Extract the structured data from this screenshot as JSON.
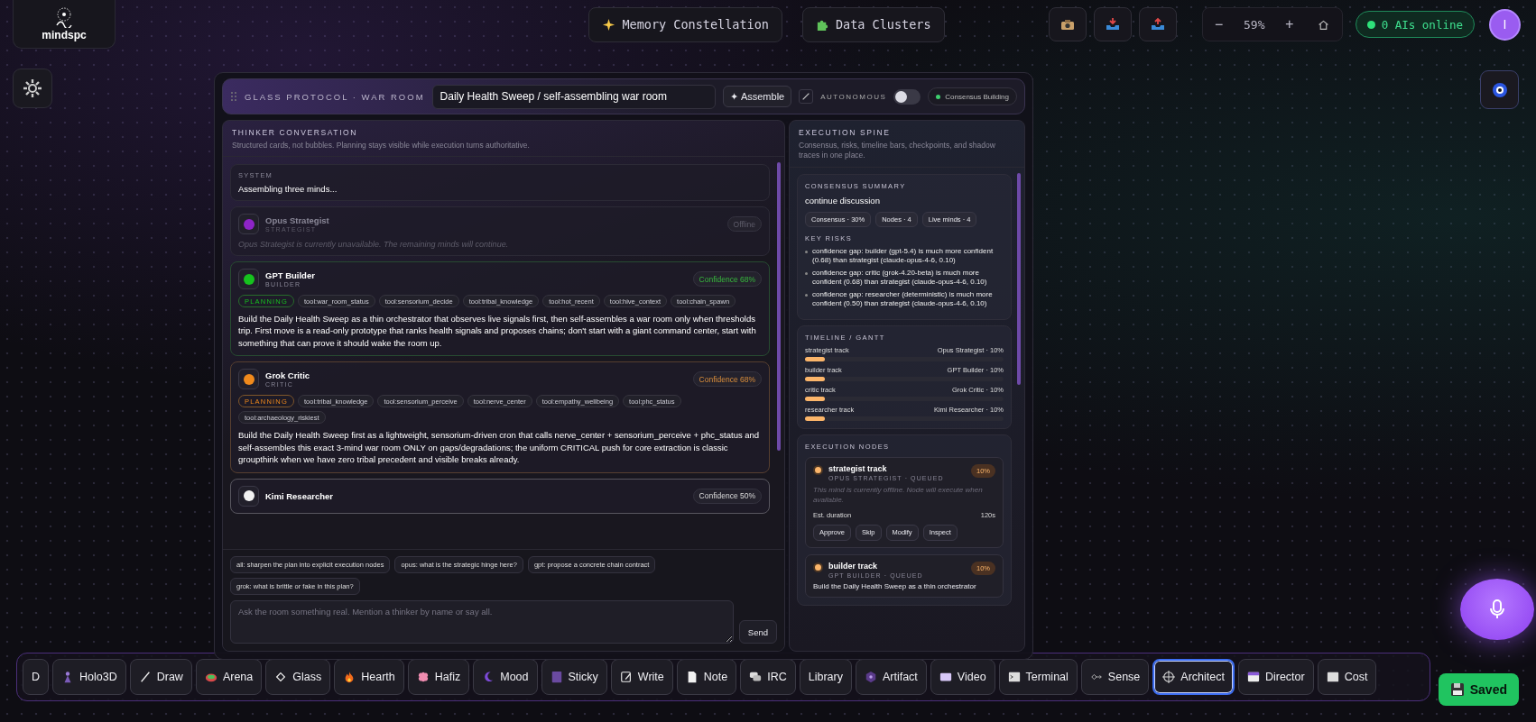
{
  "top_bar": {
    "logo": "mindspc",
    "nav": [
      {
        "label": "Memory Constellation"
      },
      {
        "label": "Data Clusters"
      }
    ],
    "zoom": {
      "minus": "−",
      "value": "59%",
      "plus": "+"
    },
    "ai_status": "0 AIs online",
    "avatar": "I"
  },
  "war_room": {
    "title": "GLASS PROTOCOL · WAR ROOM",
    "topic": "Daily Health Sweep / self-assembling war room",
    "assemble": "✦ Assemble",
    "autonomous": {
      "label": "AUTONOMOUS",
      "on": false
    },
    "status": "Consensus Building"
  },
  "conversation": {
    "title": "THINKER CONVERSATION",
    "subtitle": "Structured cards, not bubbles. Planning stays visible while execution turns authoritative.",
    "system": {
      "label": "SYSTEM",
      "text": "Assembling three minds..."
    },
    "thinkers": [
      {
        "name": "Opus Strategist",
        "role": "STRATEGIST",
        "online": false,
        "color": "#8e24c8",
        "badge": "Offline",
        "note": "Opus Strategist is currently unavailable. The remaining minds will continue."
      },
      {
        "name": "GPT Builder",
        "role": "BUILDER",
        "online": true,
        "color": "#16c21e",
        "badge": "Confidence 68%",
        "phase": "PLANNING",
        "tools": [
          "tool:war_room_status",
          "tool:sensorium_decide",
          "tool:tribal_knowledge",
          "tool:hot_recent",
          "tool:hive_context",
          "tool:chain_spawn"
        ],
        "text": "Build the Daily Health Sweep as a thin orchestrator that observes live signals first, then self-assembles a war room only when thresholds trip. First move is a read-only prototype that ranks health signals and proposes chains; don't start with a giant command center, start with something that can prove it should wake the room up."
      },
      {
        "name": "Grok Critic",
        "role": "CRITIC",
        "online": true,
        "color": "#f08a1c",
        "badge": "Confidence 68%",
        "phase": "PLANNING",
        "tools": [
          "tool:tribal_knowledge",
          "tool:sensorium_perceive",
          "tool:nerve_center",
          "tool:empathy_wellbeing",
          "tool:phc_status",
          "tool:archaeology_riskiest"
        ],
        "text": "Build the Daily Health Sweep first as a lightweight, sensorium-driven cron that calls nerve_center + sensorium_perceive + phc_status and self-assembles this exact 3-mind war room ONLY on gaps/degradations; the uniform CRITICAL push for core extraction is classic groupthink when we have zero tribal precedent and visible breaks already."
      },
      {
        "name": "Kimi Researcher",
        "online": true,
        "color": "#f2f2f2",
        "badge": "Confidence 50%"
      }
    ],
    "suggestions": [
      "all: sharpen the plan into explicit execution nodes",
      "opus: what is the strategic hinge here?",
      "gpt: propose a concrete chain contract",
      "grok: what is brittle or fake in this plan?"
    ],
    "composer": {
      "placeholder": "Ask the room something real. Mention a thinker by name or say all.",
      "send": "Send"
    }
  },
  "spine": {
    "title": "EXECUTION SPINE",
    "subtitle": "Consensus, risks, timeline bars, checkpoints, and shadow traces in one place.",
    "consensus": {
      "title": "CONSENSUS SUMMARY",
      "decision": "continue discussion",
      "chips": [
        "Consensus · 30%",
        "Nodes · 4",
        "Live minds · 4"
      ],
      "risks_title": "KEY RISKS",
      "risks": [
        "confidence gap: builder (gpt-5.4) is much more confident (0.68) than strategist (claude-opus-4-6, 0.10)",
        "confidence gap: critic (grok-4.20-beta) is much more confident (0.68) than strategist (claude-opus-4-6, 0.10)",
        "confidence gap: researcher (deterministic) is much more confident (0.50) than strategist (claude-opus-4-6, 0.10)"
      ]
    },
    "timeline": {
      "title": "TIMELINE / GANTT",
      "tracks": [
        {
          "name": "strategist track",
          "owner": "Opus Strategist · 10%",
          "level": 0.1
        },
        {
          "name": "builder track",
          "owner": "GPT Builder · 10%",
          "level": 0.1
        },
        {
          "name": "critic track",
          "owner": "Grok Critic · 10%",
          "level": 0.1
        },
        {
          "name": "researcher track",
          "owner": "Kimi Researcher · 10%",
          "level": 0.1
        }
      ]
    },
    "nodes": {
      "title": "EXECUTION NODES",
      "items": [
        {
          "name": "strategist track",
          "meta": "OPUS STRATEGIST · QUEUED",
          "badge": "10%",
          "note": "This mind is currently offline. Node will execute when available.",
          "duration_label": "Est. duration",
          "duration": "120s",
          "actions": [
            "Approve",
            "Skip",
            "Modify",
            "Inspect"
          ]
        },
        {
          "name": "builder track",
          "meta": "GPT BUILDER · QUEUED",
          "badge": "10%",
          "text": "Build the Daily Health Sweep as a thin orchestrator"
        }
      ]
    }
  },
  "dock": {
    "items": [
      {
        "label": "D",
        "selected": false
      },
      {
        "label": "Holo3D",
        "selected": false
      },
      {
        "label": "Draw",
        "selected": false
      },
      {
        "label": "Arena",
        "selected": false
      },
      {
        "label": "Glass",
        "selected": false
      },
      {
        "label": "Hearth",
        "selected": false
      },
      {
        "label": "Hafiz",
        "selected": false
      },
      {
        "label": "Mood",
        "selected": false
      },
      {
        "label": "Sticky",
        "selected": false
      },
      {
        "label": "Write",
        "selected": false
      },
      {
        "label": "Note",
        "selected": false
      },
      {
        "label": "IRC",
        "selected": false
      },
      {
        "label": "Library",
        "selected": false
      },
      {
        "label": "Artifact",
        "selected": false
      },
      {
        "label": "Video",
        "selected": false
      },
      {
        "label": "Terminal",
        "selected": false
      },
      {
        "label": "Sense",
        "selected": false
      },
      {
        "label": "Architect",
        "selected": true
      },
      {
        "label": "Director",
        "selected": false
      },
      {
        "label": "Cost",
        "selected": false
      }
    ]
  },
  "saved": "Saved"
}
